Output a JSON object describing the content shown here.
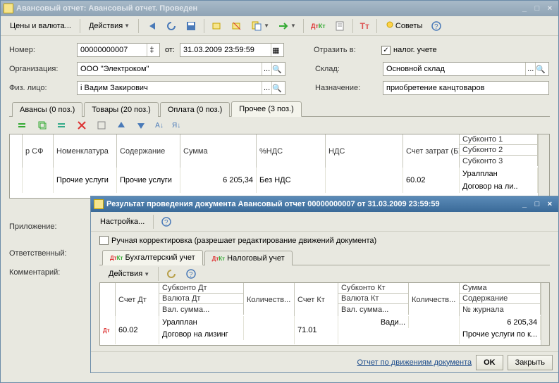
{
  "main": {
    "title": "Авансовый отчет: Авансовый отчет. Проведен",
    "toolbarText": {
      "prices": "Цены и валюта...",
      "actions": "Действия",
      "tips": "Советы"
    },
    "labels": {
      "number": "Номер:",
      "of": "от:",
      "org": "Организация:",
      "person": "Физ. лицо:",
      "reflect": "Отразить в:",
      "warehouse": "Склад:",
      "purpose": "Назначение:",
      "attachment": "Приложение:",
      "responsible": "Ответственный:",
      "comment": "Комментарий:",
      "taxacct": "налог. учете"
    },
    "values": {
      "number": "00000000007",
      "date": "31.03.2009 23:59:59",
      "org": "ООО \"Электроком\"",
      "person": "і Вадим Закирович",
      "warehouse": "Основной склад",
      "purpose": "приобретение канцтоваров",
      "taxacct_checked": true
    },
    "tabs": [
      "Авансы (0 поз.)",
      "Товары (20 поз.)",
      "Оплата (0 поз.)",
      "Прочее (3 поз.)"
    ],
    "activeTab": 3,
    "grid": {
      "headers": {
        "sf": "р СФ",
        "nomen": "Номенклатура",
        "content": "Содержание",
        "sum": "Сумма",
        "vatpct": "%НДС",
        "vat": "НДС",
        "account": "Счет затрат (БУ)",
        "sub1": "Субконто 1",
        "sub2": "Субконто 2",
        "sub3": "Субконто 3"
      },
      "rows": [
        {
          "nomen": "Прочие услуги",
          "content": "Прочие услуги",
          "sum": "6 205,34",
          "vatpct": "Без НДС",
          "vat": "",
          "account": "60.02",
          "sub1": "Уралплан",
          "sub2": "Договор на ли.."
        }
      ]
    }
  },
  "result": {
    "title": "Результат проведения документа Авансовый отчет 00000000007 от 31.03.2009 23:59:59",
    "settings": "Настройка...",
    "manual": "Ручная корректировка (разрешает редактирование движений документа)",
    "tabs": [
      "Бухгалтерский учет",
      "Налоговый учет"
    ],
    "actions": "Действия",
    "grid": {
      "headers": {
        "dt": "Счет Дт",
        "subdt": "Субконто Дт",
        "valDt": "Валюта Дт",
        "valSumDt": "Вал. сумма...",
        "qtyDt": "Количеств...",
        "kt": "Счет Кт",
        "subkt": "Субконто Кт",
        "valKt": "Валюта Кт",
        "valSumKt": "Вал. сумма...",
        "qtyKt": "Количеств...",
        "sum": "Сумма",
        "content": "Содержание",
        "journal": "№ журнала"
      },
      "row": {
        "dt": "60.02",
        "subdt1": "Уралплан",
        "subdt2": "Договор на лизинг",
        "kt": "71.01",
        "subkt": "Вади...",
        "sum": "6 205,34",
        "content": "Прочие услуги по к..."
      }
    },
    "footer": {
      "link": "Отчет по движениям документа",
      "ok": "OK",
      "close": "Закрыть"
    }
  }
}
